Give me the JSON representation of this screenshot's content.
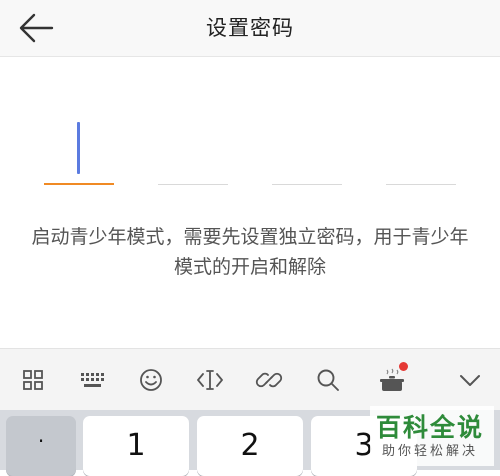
{
  "header": {
    "title": "设置密码",
    "back_icon": "arrow-left-icon"
  },
  "pin": {
    "slots": 4,
    "active_index": 0,
    "active_color": "#f08a24",
    "cursor_color": "#5b7be0"
  },
  "description": "启动青少年模式，需要先设置独立密码，用于青少年模式的开启和解除",
  "keyboard_toolbar": {
    "icons": [
      "grid-icon",
      "keyboard-icon",
      "emoji-icon",
      "text-cursor-icon",
      "link-icon",
      "search-icon",
      "pot-icon",
      "chevron-down-icon"
    ],
    "notification_dot_color": "#e53935"
  },
  "keys": {
    "k0": "·",
    "k1": "1",
    "k2": "2",
    "k3": "3"
  },
  "watermark": {
    "title": "百科全说",
    "subtitle": "助你轻松解决"
  }
}
